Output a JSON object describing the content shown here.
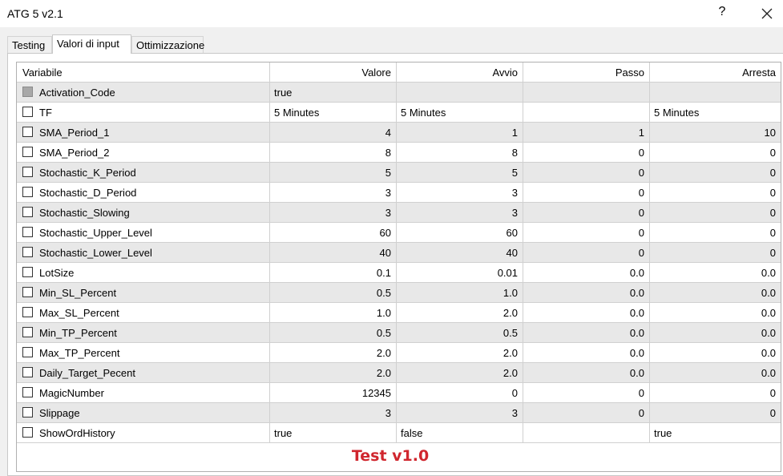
{
  "window": {
    "title": "ATG 5 v2.1",
    "help": "?"
  },
  "tabs": [
    {
      "label": "Testing"
    },
    {
      "label": "Valori di input"
    },
    {
      "label": "Ottimizzazione"
    }
  ],
  "table": {
    "columns": [
      "Variabile",
      "Valore",
      "Avvio",
      "Passo",
      "Arresta"
    ],
    "rows": [
      {
        "name": "Activation_Code",
        "value": "true",
        "start": "",
        "step": "",
        "stop": "",
        "checkbox_disabled": true
      },
      {
        "name": "TF",
        "value": "5 Minutes",
        "start": "5 Minutes",
        "step": "",
        "stop": "5 Minutes"
      },
      {
        "name": "SMA_Period_1",
        "value": "4",
        "start": "1",
        "step": "1",
        "stop": "10"
      },
      {
        "name": "SMA_Period_2",
        "value": "8",
        "start": "8",
        "step": "0",
        "stop": "0"
      },
      {
        "name": "Stochastic_K_Period",
        "value": "5",
        "start": "5",
        "step": "0",
        "stop": "0"
      },
      {
        "name": "Stochastic_D_Period",
        "value": "3",
        "start": "3",
        "step": "0",
        "stop": "0"
      },
      {
        "name": "Stochastic_Slowing",
        "value": "3",
        "start": "3",
        "step": "0",
        "stop": "0"
      },
      {
        "name": "Stochastic_Upper_Level",
        "value": "60",
        "start": "60",
        "step": "0",
        "stop": "0"
      },
      {
        "name": "Stochastic_Lower_Level",
        "value": "40",
        "start": "40",
        "step": "0",
        "stop": "0"
      },
      {
        "name": "LotSize",
        "value": "0.1",
        "start": "0.01",
        "step": "0.0",
        "stop": "0.0"
      },
      {
        "name": "Min_SL_Percent",
        "value": "0.5",
        "start": "1.0",
        "step": "0.0",
        "stop": "0.0"
      },
      {
        "name": "Max_SL_Percent",
        "value": "1.0",
        "start": "2.0",
        "step": "0.0",
        "stop": "0.0"
      },
      {
        "name": "Min_TP_Percent",
        "value": "0.5",
        "start": "0.5",
        "step": "0.0",
        "stop": "0.0"
      },
      {
        "name": "Max_TP_Percent",
        "value": "2.0",
        "start": "2.0",
        "step": "0.0",
        "stop": "0.0"
      },
      {
        "name": "Daily_Target_Pecent",
        "value": "2.0",
        "start": "2.0",
        "step": "0.0",
        "stop": "0.0"
      },
      {
        "name": "MagicNumber",
        "value": "12345",
        "start": "0",
        "step": "0",
        "stop": "0"
      },
      {
        "name": "Slippage",
        "value": "3",
        "start": "3",
        "step": "0",
        "stop": "0"
      },
      {
        "name": "ShowOrdHistory",
        "value": "true",
        "start": "false",
        "step": "",
        "stop": "true"
      }
    ]
  },
  "footer": {
    "text": "Test v1.0",
    "color": "#d0262e"
  }
}
